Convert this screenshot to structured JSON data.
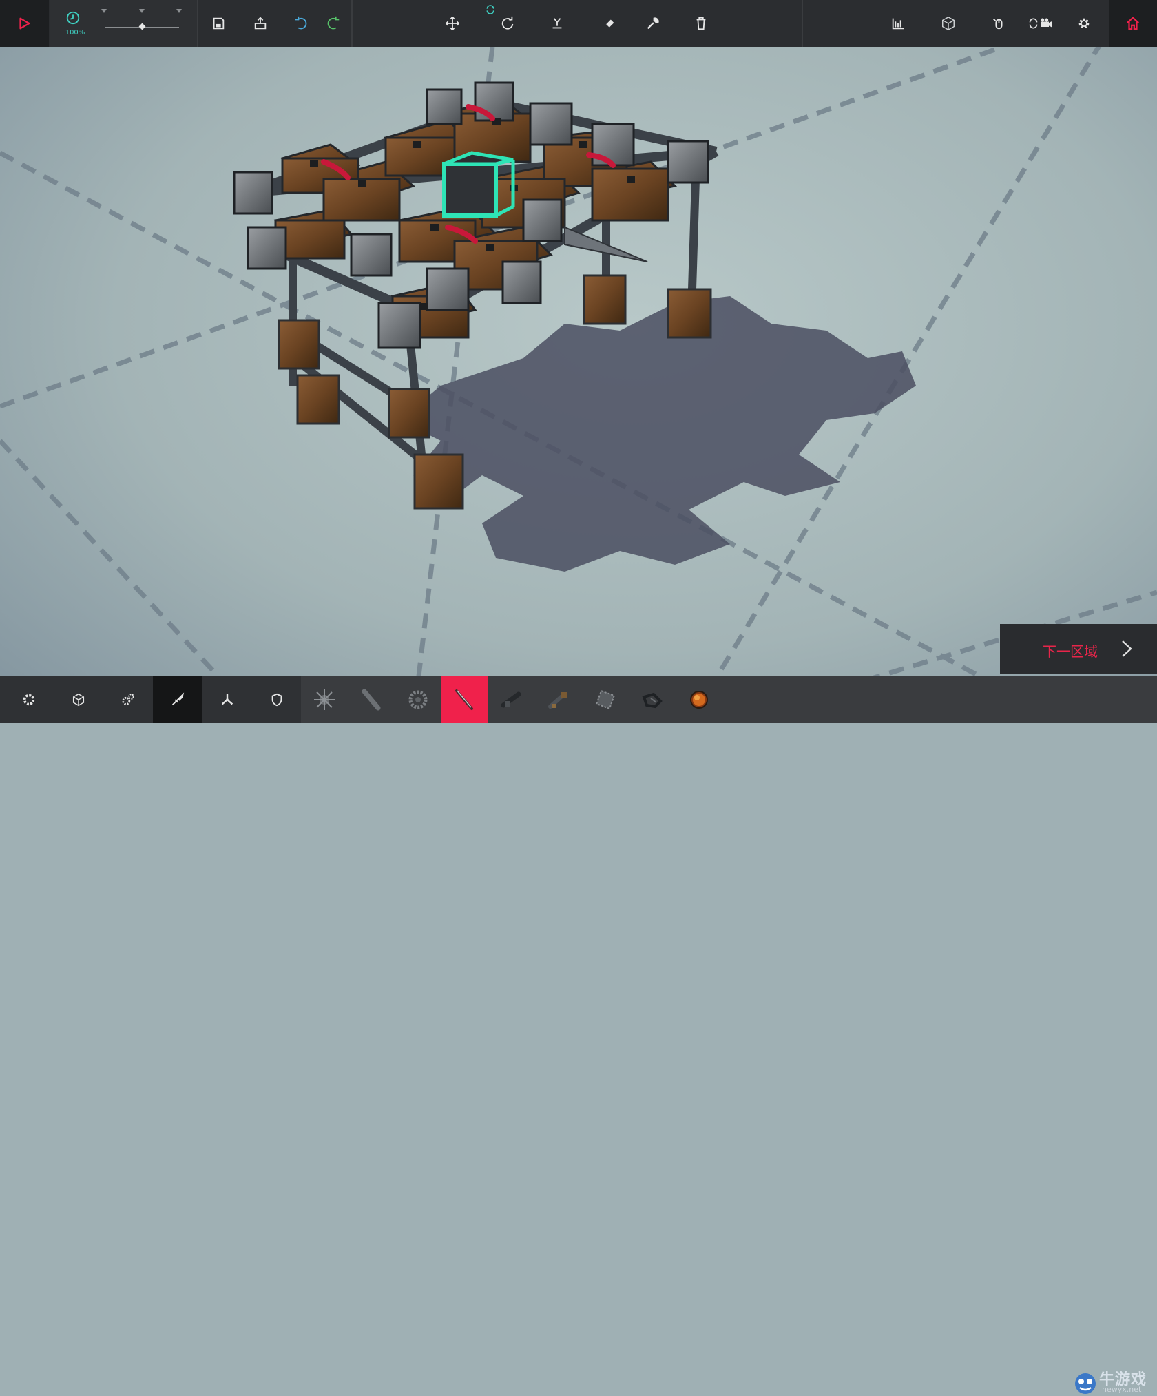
{
  "speed": {
    "value_label": "100%"
  },
  "next_zone": {
    "label": "下一区域"
  },
  "watermark": {
    "brand": "牛游戏",
    "url": "newyx.net"
  },
  "colors": {
    "accent_red": "#f0214b",
    "accent_teal": "#3fd0c2",
    "bar_bg": "#2b2d30"
  },
  "toolbar_icons": [
    "play-icon",
    "speed-icon",
    "save-icon",
    "load-icon",
    "undo-icon",
    "redo-icon",
    "move-icon",
    "rotate-icon",
    "flip-icon",
    "paint-icon",
    "wrench-icon",
    "trash-icon",
    "stats-icon",
    "cube-view-icon",
    "mouse-control-icon",
    "camera-icon",
    "gear-icon",
    "home-icon"
  ],
  "bottom_categories": [
    "basic-icon",
    "block-icon",
    "mechanical-icon",
    "weapon-icon",
    "propulsion-icon",
    "armour-icon"
  ],
  "bottom_blocks": [
    "spike-ball-icon",
    "plank-icon",
    "saw-icon",
    "blade-icon",
    "cannon-icon",
    "crossbow-icon",
    "grinder-icon",
    "drill-icon",
    "bomb-icon"
  ]
}
